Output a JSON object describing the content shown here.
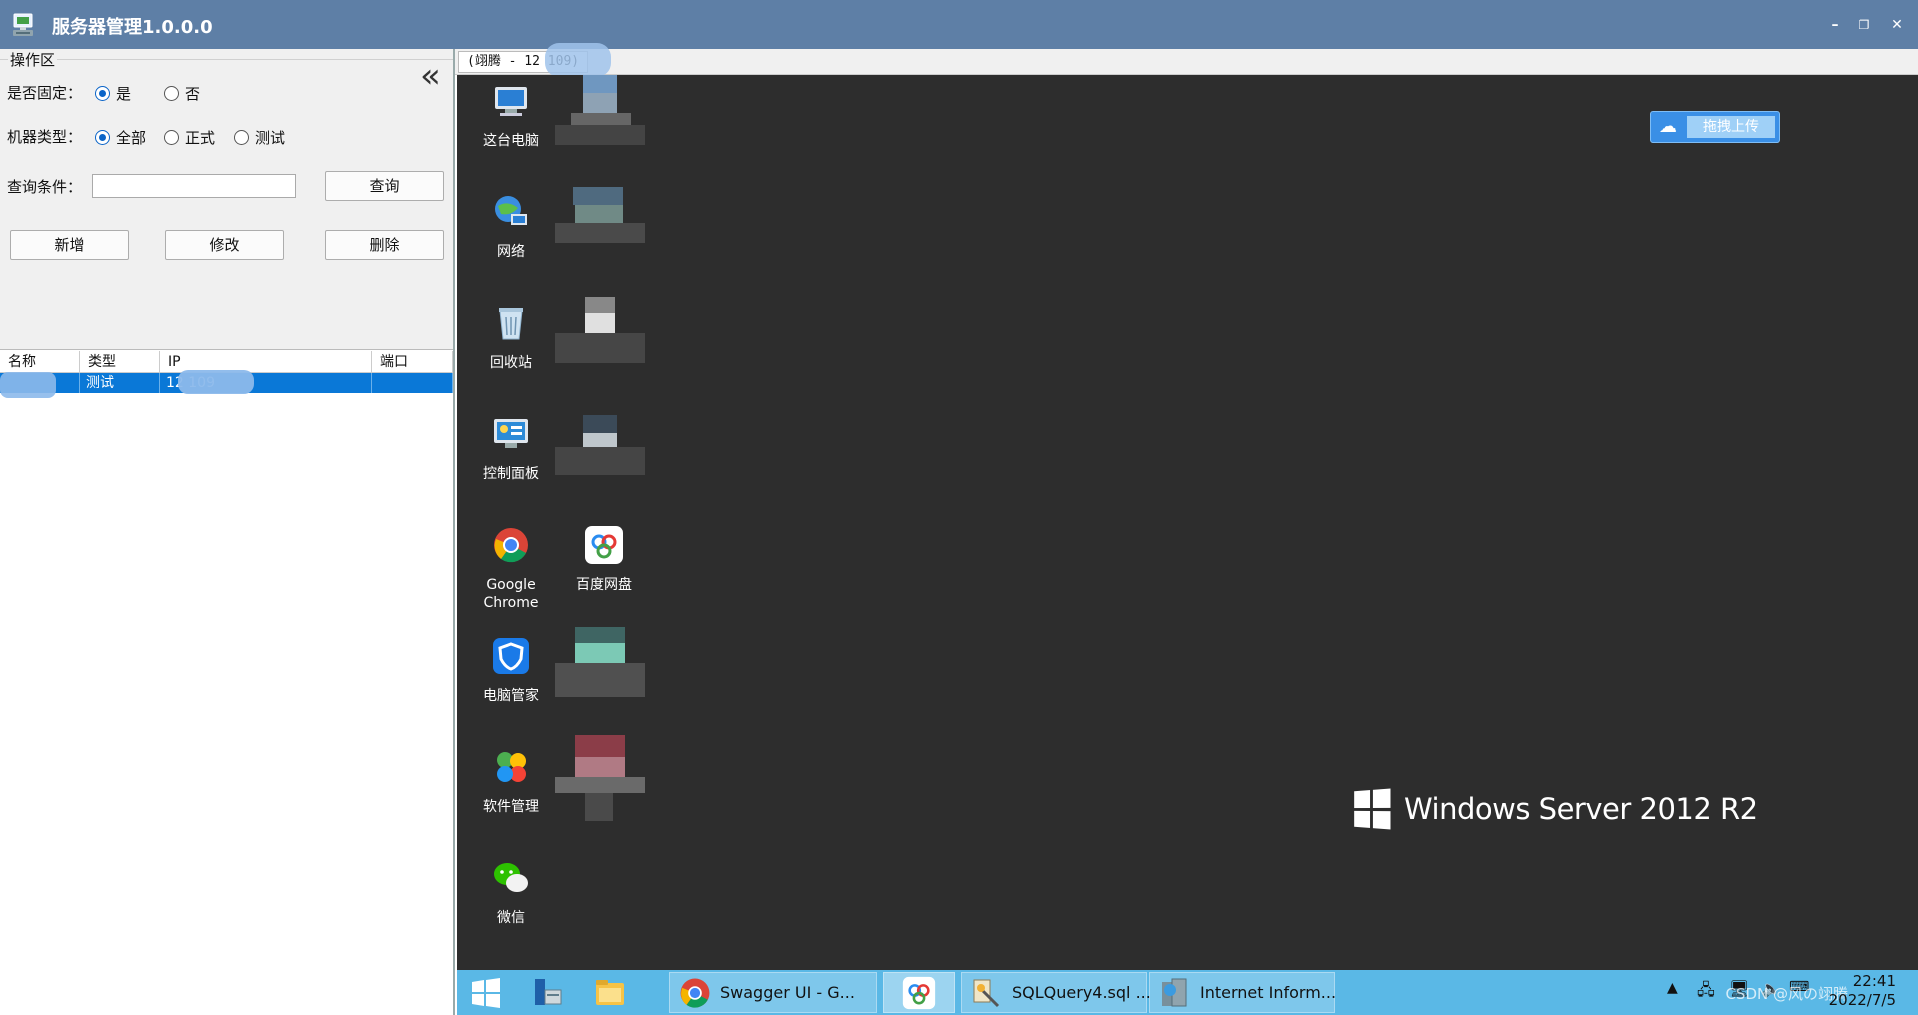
{
  "window": {
    "title": "服务器管理1.0.0.0",
    "minimize": "–",
    "restore": "❐",
    "close": "✕"
  },
  "operation_zone": {
    "legend": "操作区",
    "collapse_icon": "«",
    "fixed_label": "是否固定：",
    "fixed_options": [
      "是",
      "否"
    ],
    "fixed_selected": "是",
    "type_label": "机器类型：",
    "type_options": [
      "全部",
      "正式",
      "测试"
    ],
    "type_selected": "全部",
    "query_label": "查询条件：",
    "query_value": "",
    "query_button": "查询",
    "add_button": "新增",
    "edit_button": "修改",
    "delete_button": "删除"
  },
  "server_table": {
    "columns": [
      "名称",
      "类型",
      "IP",
      "端口"
    ],
    "rows": [
      {
        "name": "",
        "type": "测试",
        "ip": "12          109",
        "port": ""
      }
    ]
  },
  "remote_tab": {
    "label": "(翊腾 - 12          109)"
  },
  "desktop": {
    "icons": [
      {
        "label": "这台电脑",
        "icon": "computer-icon"
      },
      {
        "label": "网络",
        "icon": "network-icon"
      },
      {
        "label": "回收站",
        "icon": "recycle-bin-icon"
      },
      {
        "label": "控制面板",
        "icon": "control-panel-icon"
      },
      {
        "label": "Google Chrome",
        "icon": "chrome-icon"
      },
      {
        "label": "电脑管家",
        "icon": "pc-manager-icon"
      },
      {
        "label": "软件管理",
        "icon": "software-manager-icon"
      },
      {
        "label": "微信",
        "icon": "wechat-icon"
      },
      {
        "label": "百度网盘",
        "icon": "baidu-netdisk-icon"
      }
    ],
    "upload_button": "拖拽上传",
    "os_brand": "Windows Server 2012 R2"
  },
  "taskbar": {
    "apps": [
      {
        "label": "Swagger UI - G...",
        "icon": "chrome-icon"
      },
      {
        "label": "SQLQuery4.sql ...",
        "icon": "sql-icon"
      },
      {
        "label": "Internet Inform...",
        "icon": "iis-icon"
      }
    ],
    "time": "22:41",
    "date": "2022/7/5",
    "watermark": "CSDN @风の翊腾"
  },
  "colors": {
    "titlebar": "#5e7fa6",
    "selection": "#0a78d7",
    "desktop": "#2d2d2d",
    "taskbar": "#5ab8e6"
  }
}
